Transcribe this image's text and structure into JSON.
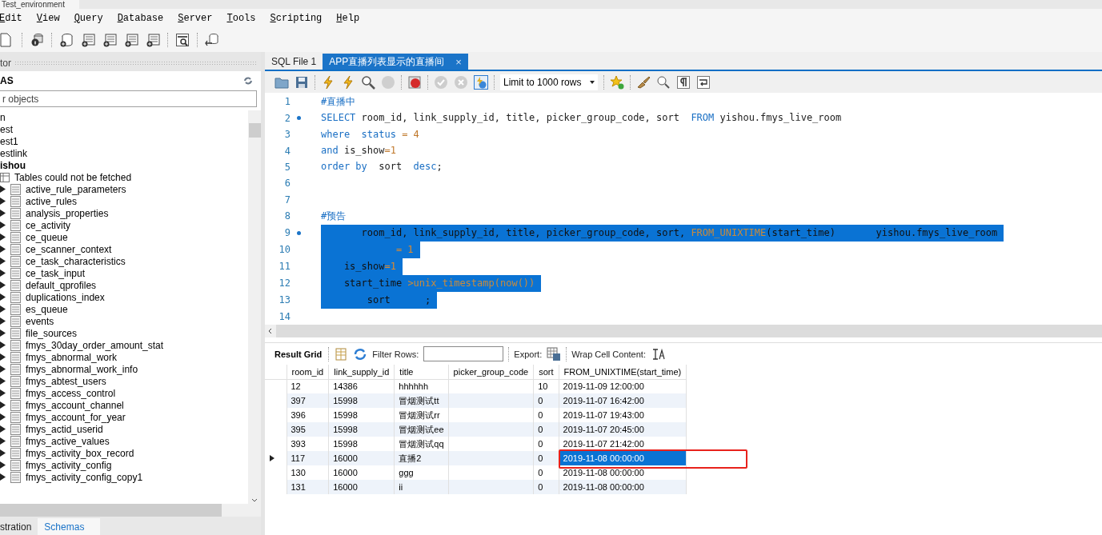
{
  "window": {
    "tab_title": "Test_environment"
  },
  "menu": [
    "Edit",
    "View",
    "Query",
    "Database",
    "Server",
    "Tools",
    "Scripting",
    "Help"
  ],
  "navigator": {
    "title": "tor",
    "section": "AS",
    "filter": {
      "placeholder": "r objects"
    },
    "tree": [
      {
        "label": "n",
        "bold": false
      },
      {
        "label": "est",
        "bold": false
      },
      {
        "label": "est1",
        "bold": false
      },
      {
        "label": "estlink",
        "bold": false
      },
      {
        "label": "ishou",
        "bold": true,
        "children": [
          {
            "label": "Tables could not be fetched",
            "kind": "message"
          },
          {
            "label": "active_rule_parameters",
            "kind": "table"
          },
          {
            "label": "active_rules",
            "kind": "table"
          },
          {
            "label": "analysis_properties",
            "kind": "table"
          },
          {
            "label": "ce_activity",
            "kind": "table"
          },
          {
            "label": "ce_queue",
            "kind": "table"
          },
          {
            "label": "ce_scanner_context",
            "kind": "table"
          },
          {
            "label": "ce_task_characteristics",
            "kind": "table"
          },
          {
            "label": "ce_task_input",
            "kind": "table"
          },
          {
            "label": "default_qprofiles",
            "kind": "table"
          },
          {
            "label": "duplications_index",
            "kind": "table"
          },
          {
            "label": "es_queue",
            "kind": "table"
          },
          {
            "label": "events",
            "kind": "table"
          },
          {
            "label": "file_sources",
            "kind": "table"
          },
          {
            "label": "fmys_30day_order_amount_stat",
            "kind": "table"
          },
          {
            "label": "fmys_abnormal_work",
            "kind": "table"
          },
          {
            "label": "fmys_abnormal_work_info",
            "kind": "table"
          },
          {
            "label": "fmys_abtest_users",
            "kind": "table"
          },
          {
            "label": "fmys_access_control",
            "kind": "table"
          },
          {
            "label": "fmys_account_channel",
            "kind": "table"
          },
          {
            "label": "fmys_account_for_year",
            "kind": "table"
          },
          {
            "label": "fmys_actid_userid",
            "kind": "table"
          },
          {
            "label": "fmys_active_values",
            "kind": "table"
          },
          {
            "label": "fmys_activity_box_record",
            "kind": "table"
          },
          {
            "label": "fmys_activity_config",
            "kind": "table"
          },
          {
            "label": "fmys_activity_config_copy1",
            "kind": "table"
          }
        ]
      }
    ],
    "bottom_tabs": [
      {
        "label": "stration",
        "selected": false
      },
      {
        "label": "Schemas",
        "selected": true
      }
    ]
  },
  "editor": {
    "tabs": [
      {
        "label": "SQL File 1",
        "selected": false
      },
      {
        "label": "APP直播列表显示的直播间",
        "selected": true,
        "close": "×"
      }
    ],
    "limit": "Limit to 1000 rows",
    "lines": [
      {
        "number": "1",
        "marker": false,
        "selected": false,
        "tokens": [
          {
            "kind": "comment",
            "text": "#直播中"
          }
        ]
      },
      {
        "number": "2",
        "marker": true,
        "selected": false,
        "tokens": [
          {
            "kind": "keyword",
            "text": "SELECT"
          },
          {
            "kind": "plain",
            "text": " room_id, link_supply_id, title, picker_group_code, sort  "
          },
          {
            "kind": "keyword",
            "text": "FROM"
          },
          {
            "kind": "plain",
            "text": " yishou.fmys_live_room"
          }
        ]
      },
      {
        "number": "3",
        "marker": false,
        "selected": false,
        "tokens": [
          {
            "kind": "keyword",
            "text": "where"
          },
          {
            "kind": "keyword",
            "text": "  status"
          },
          {
            "kind": "number",
            "text": " = 4"
          }
        ]
      },
      {
        "number": "4",
        "marker": false,
        "selected": false,
        "tokens": [
          {
            "kind": "keyword",
            "text": "and"
          },
          {
            "kind": "plain",
            "text": " is_show"
          },
          {
            "kind": "number",
            "text": "=1"
          }
        ]
      },
      {
        "number": "5",
        "marker": false,
        "selected": false,
        "tokens": [
          {
            "kind": "keyword",
            "text": "order by"
          },
          {
            "kind": "plain",
            "text": "  sort  "
          },
          {
            "kind": "keyword",
            "text": "desc"
          },
          {
            "kind": "plain",
            "text": ";"
          }
        ]
      },
      {
        "number": "6",
        "marker": false,
        "selected": false
      },
      {
        "number": "7",
        "marker": false,
        "selected": false
      },
      {
        "number": "8",
        "marker": false,
        "selected": false,
        "tokens": [
          {
            "kind": "comment",
            "text": "#预告"
          }
        ]
      },
      {
        "number": "9",
        "marker": true,
        "selected": true,
        "tokens": [
          {
            "kind": "plain",
            "text": "       room_id, link_supply_id, title, picker_group_code, sort, "
          },
          {
            "kind": "function",
            "text": "FROM_UNIXTIME"
          },
          {
            "kind": "plain",
            "text": "(start_time)       yishou.fmys_live_room"
          }
        ]
      },
      {
        "number": "10",
        "marker": false,
        "selected": true,
        "tokens": [
          {
            "kind": "number",
            "text": "             = 1"
          }
        ]
      },
      {
        "number": "11",
        "marker": false,
        "selected": true,
        "tokens": [
          {
            "kind": "plain",
            "text": "    is_show"
          },
          {
            "kind": "number",
            "text": "=1"
          }
        ]
      },
      {
        "number": "12",
        "marker": false,
        "selected": true,
        "tokens": [
          {
            "kind": "plain",
            "text": "    start_time "
          },
          {
            "kind": "function",
            "text": ">unix_timestamp(now())"
          }
        ]
      },
      {
        "number": "13",
        "marker": false,
        "selected": true,
        "tokens": [
          {
            "kind": "plain",
            "text": "        sort      ;"
          }
        ]
      },
      {
        "number": "14",
        "marker": false,
        "selected": false
      }
    ]
  },
  "results": {
    "tab": "Result Grid",
    "filter_label": "Filter Rows:",
    "export_label": "Export:",
    "wrap_label": "Wrap Cell Content:",
    "columns": [
      "room_id",
      "link_supply_id",
      "title",
      "picker_group_code",
      "sort",
      "FROM_UNIXTIME(start_time)"
    ],
    "rows": [
      {
        "cells": [
          "12",
          "14386",
          "hhhhhh",
          "",
          "10",
          "2019-11-09 12:00:00"
        ],
        "selected": false,
        "circled": false
      },
      {
        "cells": [
          "397",
          "15998",
          "冒烟测试tt",
          "",
          "0",
          "2019-11-07 16:42:00"
        ],
        "selected": false,
        "circled": false
      },
      {
        "cells": [
          "396",
          "15998",
          "冒烟测试rr",
          "",
          "0",
          "2019-11-07 19:43:00"
        ],
        "selected": false,
        "circled": false
      },
      {
        "cells": [
          "395",
          "15998",
          "冒烟测试ee",
          "",
          "0",
          "2019-11-07 20:45:00"
        ],
        "selected": false,
        "circled": false
      },
      {
        "cells": [
          "393",
          "15998",
          "冒烟测试qq",
          "",
          "0",
          "2019-11-07 21:42:00"
        ],
        "selected": false,
        "circled": false
      },
      {
        "cells": [
          "117",
          "16000",
          "直播2",
          "",
          "0",
          "2019-11-08 00:00:00"
        ],
        "selected": true,
        "circled": true
      },
      {
        "cells": [
          "130",
          "16000",
          "ggg",
          "",
          "0",
          "2019-11-08 00:00:00"
        ],
        "selected": false,
        "circled": false
      },
      {
        "cells": [
          "131",
          "16000",
          "ii",
          "",
          "0",
          "2019-11-08 00:00:00"
        ],
        "selected": false,
        "circled": false
      }
    ]
  }
}
